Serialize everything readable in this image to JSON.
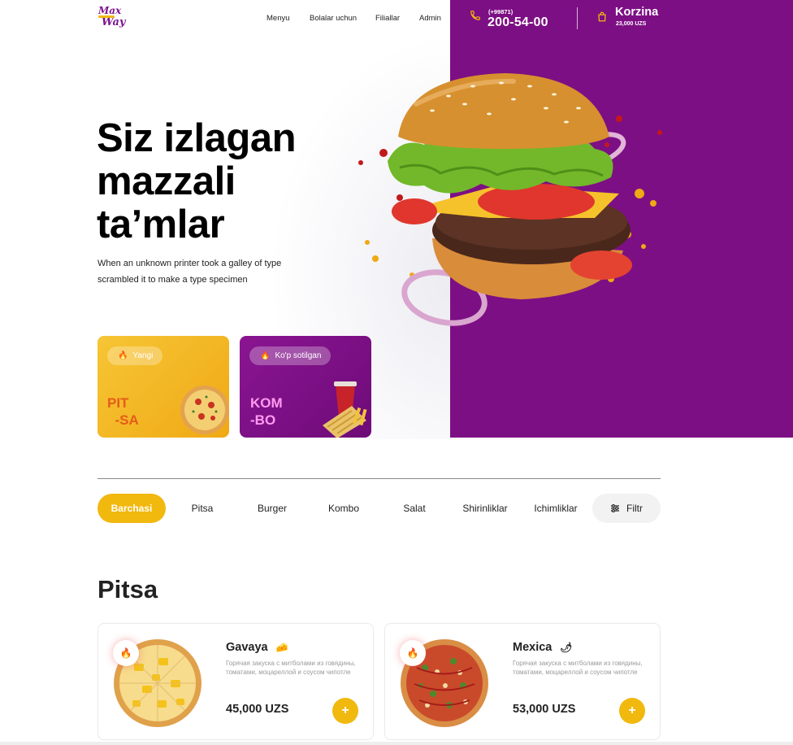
{
  "header": {
    "logo_text": "Max Way",
    "nav": [
      "Menyu",
      "Bolalar uchun",
      "Filiallar",
      "Admin"
    ],
    "phone_prefix": "(+99871)",
    "phone_number": "200-54-00",
    "cart_label": "Korzina",
    "cart_total": "23,000 UZS"
  },
  "hero": {
    "title": "Siz izlagan mazzali ta’mlar",
    "subtitle": "When an unknown printer took a galley of type scrambled it to make a type specimen"
  },
  "promos": [
    {
      "badge": "Yangi",
      "text": "PIT\n  -SA",
      "badge_icon": "fire-icon"
    },
    {
      "badge": "Ko'p sotilgan",
      "text": "KOM\n-BO",
      "badge_icon": "fire-icon"
    }
  ],
  "categories": {
    "items": [
      "Barchasi",
      "Pitsa",
      "Burger",
      "Kombo",
      "Salat",
      "Shirinliklar",
      "Ichimliklar"
    ],
    "active": "Barchasi",
    "filter_label": "Filtr"
  },
  "section": {
    "title": "Pitsa"
  },
  "products": [
    {
      "name": "Gavaya",
      "tag_icon": "cheese-icon",
      "desc": "Горячая закуска с митболами из говядины, томатами, моцареллой и соусом чипотле",
      "price": "45,000 UZS"
    },
    {
      "name": "Mexica",
      "tag_icon": "chili-pepper-icon",
      "desc": "Горячая закуска с митболами из говядины, томатами, моцареллой и соусом чипотле",
      "price": "53,000 UZS"
    }
  ],
  "colors": {
    "brand_purple": "#7d0f84",
    "accent_yellow": "#f1b80e"
  }
}
